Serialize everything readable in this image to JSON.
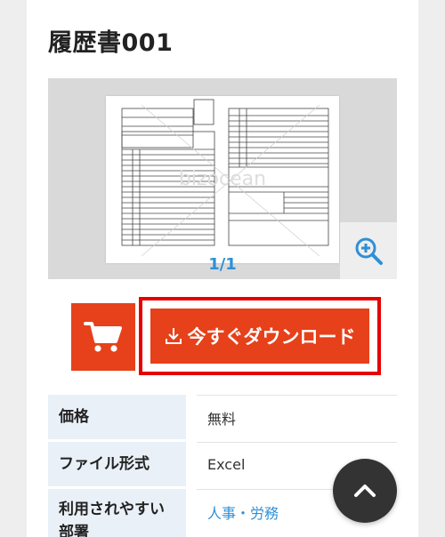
{
  "page": {
    "title": "履歴書001"
  },
  "preview": {
    "pager": "1/1",
    "watermark": "bizocean"
  },
  "actions": {
    "download_label": "今すぐダウンロード",
    "cart_icon": "cart-icon",
    "zoom_icon": "zoom-in-icon",
    "download_icon": "download-icon",
    "scroll_top_icon": "chevron-up-icon"
  },
  "spec": {
    "rows": [
      {
        "label": "価格",
        "value": "無料"
      },
      {
        "label": "ファイル形式",
        "value": "Excel"
      },
      {
        "label": "利用されやすい\n部署",
        "value": "人事・労務"
      }
    ]
  },
  "colors": {
    "accent": "#e6411a",
    "highlight_border": "#e60000",
    "link": "#2f8fd6",
    "table_header_bg": "#eaf0f8"
  }
}
